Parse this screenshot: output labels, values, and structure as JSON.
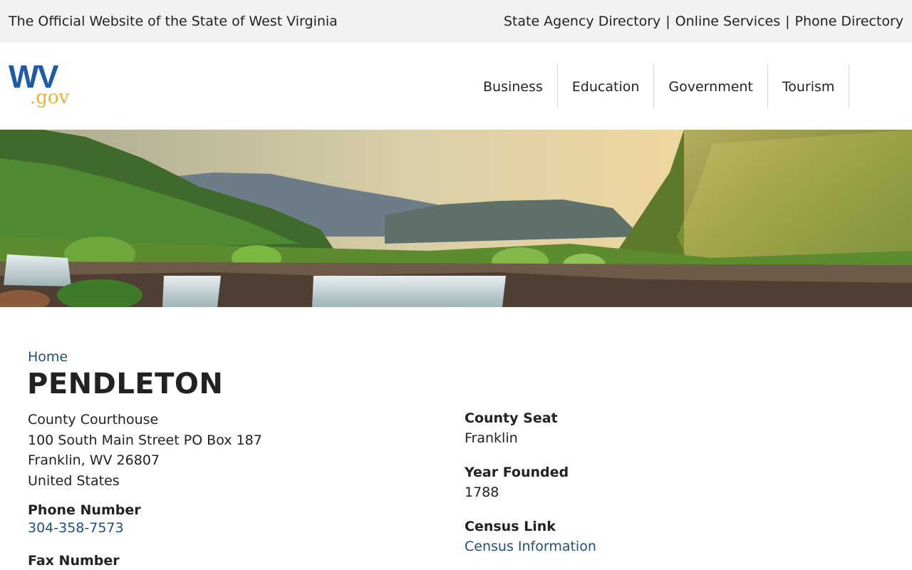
{
  "topbar": {
    "site_title": "The Official Website of the State of West Virginia",
    "links": [
      "State Agency Directory",
      "Online Services",
      "Phone Directory"
    ],
    "separator": "|"
  },
  "logo": {
    "main": "WV",
    "suffix": ".gov",
    "main_color": "#1f5aa6",
    "suffix_color": "#e8b33a"
  },
  "nav": [
    "Business",
    "Education",
    "Government",
    "Tourism"
  ],
  "hero": {
    "description_icon": "landscape-photo"
  },
  "breadcrumb": {
    "home": "Home"
  },
  "page": {
    "title": "PENDLETON",
    "address": {
      "line1": "County Courthouse",
      "line2": "100 South Main Street PO Box 187",
      "line3": "Franklin, WV 26807",
      "line4": "United States"
    },
    "phone": {
      "label": "Phone Number",
      "value": "304-358-7573"
    },
    "fax": {
      "label": "Fax Number"
    },
    "county_seat": {
      "label": "County Seat",
      "value": "Franklin"
    },
    "year_founded": {
      "label": "Year Founded",
      "value": "1788"
    },
    "census": {
      "label": "Census Link",
      "value": "Census Information"
    }
  },
  "colors": {
    "link": "#1f4f7f",
    "topbar_bg": "#f2f2f2",
    "text": "#222222"
  }
}
